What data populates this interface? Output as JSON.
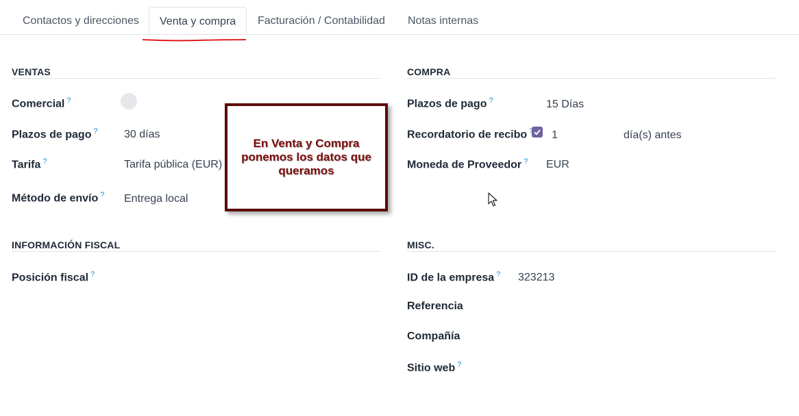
{
  "tabs": [
    {
      "label": "Contactos y direcciones"
    },
    {
      "label": "Venta y compra"
    },
    {
      "label": "Facturación / Contabilidad"
    },
    {
      "label": "Notas internas"
    }
  ],
  "active_tab": "Venta y compra",
  "sections": {
    "ventas": {
      "title": "VENTAS",
      "comercial_label": "Comercial",
      "plazos_label": "Plazos de pago",
      "plazos_value": "30 días",
      "tarifa_label": "Tarifa",
      "tarifa_value": "Tarifa pública (EUR)",
      "envio_label": "Método de envío",
      "envio_value": "Entrega local"
    },
    "compra": {
      "title": "COMPRA",
      "plazos_label": "Plazos de pago",
      "plazos_value": "15 Días",
      "recordatorio_label": "Recordatorio de recibo",
      "recordatorio_checked": true,
      "recordatorio_days": "1",
      "recordatorio_suffix": "día(s) antes",
      "moneda_label": "Moneda de Proveedor",
      "moneda_value": "EUR"
    },
    "fiscal": {
      "title": "INFORMACIÓN FISCAL",
      "posicion_label": "Posición fiscal"
    },
    "misc": {
      "title": "MISC.",
      "id_label": "ID de la empresa",
      "id_value": "323213",
      "referencia_label": "Referencia",
      "compania_label": "Compañía",
      "sitio_label": "Sitio web"
    }
  },
  "help_marker": "?",
  "annotation": {
    "text": "En Venta y Compra ponemos los datos que queramos"
  },
  "colors": {
    "accent_checkbox": "#71639e",
    "help": "#1d8fc7",
    "annotation_border": "#5c0a0a",
    "annotation_text": "#7a0c0c",
    "underline": "#e11d1d"
  }
}
